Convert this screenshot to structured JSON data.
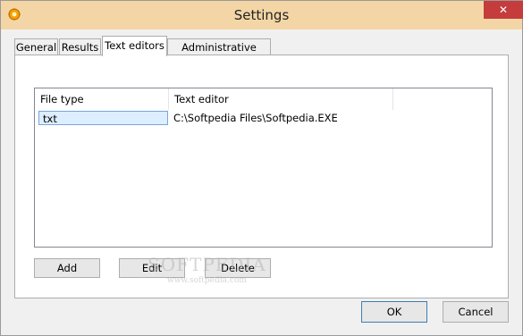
{
  "window": {
    "title": "Settings",
    "close_glyph": "✕",
    "app_icon": "gear-icon"
  },
  "tabs": [
    {
      "label": "General"
    },
    {
      "label": "Results"
    },
    {
      "label": "Text editors",
      "active": true
    },
    {
      "label": "Administrative Options"
    }
  ],
  "list": {
    "columns": [
      "File type",
      "Text editor"
    ],
    "rows": [
      {
        "file_type": "txt",
        "text_editor": "C:\\Softpedia Files\\Softpedia.EXE",
        "selected": true
      }
    ]
  },
  "buttons": {
    "add": "Add",
    "edit": "Edit",
    "delete": "Delete",
    "ok": "OK",
    "cancel": "Cancel"
  },
  "watermark": {
    "main": "SOFTPEDIA",
    "sub": "www.softpedia.com"
  },
  "colors": {
    "titlebar": "#f4d6a6",
    "close_button": "#c43c3c",
    "selection": "#dceeff"
  }
}
